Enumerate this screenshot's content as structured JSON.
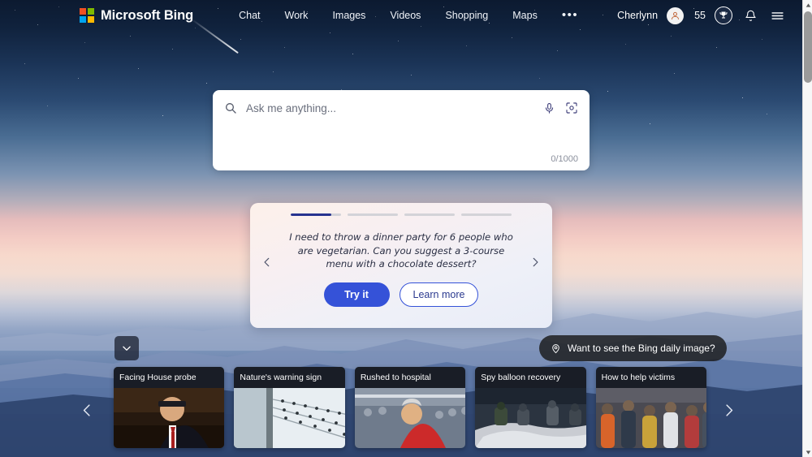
{
  "brand": {
    "name": "Microsoft Bing",
    "logo_colors": [
      "#f25022",
      "#7fba00",
      "#00a4ef",
      "#ffb900"
    ]
  },
  "nav": {
    "items": [
      {
        "label": "Chat",
        "name": "nav-chat"
      },
      {
        "label": "Work",
        "name": "nav-work"
      },
      {
        "label": "Images",
        "name": "nav-images"
      },
      {
        "label": "Videos",
        "name": "nav-videos"
      },
      {
        "label": "Shopping",
        "name": "nav-shopping"
      },
      {
        "label": "Maps",
        "name": "nav-maps"
      }
    ],
    "more_label": "•••"
  },
  "account": {
    "user_name": "Cherlynn",
    "avatar_icon": "person-icon",
    "points": "55",
    "rewards_icon": "trophy-icon",
    "notifications_icon": "bell-icon",
    "menu_icon": "hamburger-menu-icon"
  },
  "search": {
    "placeholder": "Ask me anything...",
    "value": "",
    "char_count": "0/1000",
    "search_icon": "search-icon",
    "mic_icon": "microphone-icon",
    "visual_search_icon": "visual-search-icon"
  },
  "suggestion_card": {
    "prompt": "I need to throw a dinner party for 6 people who are vegetarian. Can you suggest a 3-course menu with a chocolate dessert?",
    "try_label": "Try it",
    "learn_label": "Learn more",
    "prev_icon": "chevron-left-icon",
    "next_icon": "chevron-right-icon",
    "progress": [
      80,
      0,
      0,
      0
    ],
    "active_color": "#26338f",
    "track_color": "#d3d3d8"
  },
  "daily_image_pill": {
    "label": "Want to see the Bing daily image?",
    "icon": "location-pin-icon"
  },
  "collapse_button": {
    "icon": "chevron-down-icon"
  },
  "news": {
    "prev_icon": "chevron-left-icon",
    "next_icon": "chevron-right-icon",
    "cards": [
      {
        "title": "Facing House probe",
        "thumb": "man-in-suit-at-hearing"
      },
      {
        "title": "Nature's warning sign",
        "thumb": "birds-on-power-lines"
      },
      {
        "title": "Rushed to hospital",
        "thumb": "man-in-red-shirt-crowd"
      },
      {
        "title": "Spy balloon recovery",
        "thumb": "sailors-recovering-debris"
      },
      {
        "title": "How to help victims",
        "thumb": "crowd-of-people-aid"
      }
    ]
  },
  "background": {
    "description": "twilight mountain landscape with starry sky and pink sunset",
    "sky_top": "#0c1a30",
    "sunset_band": "#f3cbc4",
    "mountain_base": "#1f3558"
  },
  "scrollbar": {
    "up_icon": "scroll-up-arrow-icon",
    "down_icon": "scroll-down-arrow-icon",
    "thumb_name": "scrollbar-thumb"
  }
}
